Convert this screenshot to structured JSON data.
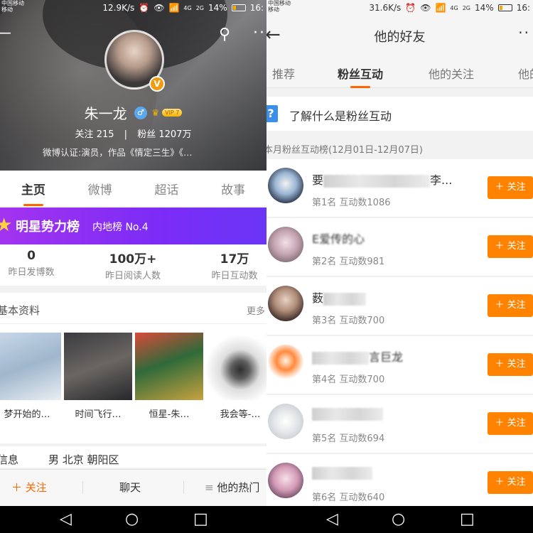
{
  "left": {
    "status": {
      "carrier_line1": "中国移动",
      "carrier_line2": "移动",
      "speed": "12.9K/s",
      "signal1": "4G",
      "signal2": "2G",
      "battery": "14%",
      "time": "16:"
    },
    "profile": {
      "name": "朱一龙",
      "gender_icon": "male-icon",
      "vip_label": "VIP 7",
      "following_label": "关注",
      "following_count": "215",
      "followers_label": "粉丝",
      "followers_count": "1207万",
      "verification": "微博认证:演员，作品《情定三生》《…"
    },
    "tabs": [
      "主页",
      "微博",
      "超话",
      "故事"
    ],
    "banner": {
      "title": "明星势力榜",
      "rank": "内地榜 No.4"
    },
    "numbers": [
      {
        "value": "0",
        "label": "昨日发博数"
      },
      {
        "value": "100万+",
        "label": "昨日阅读人数"
      },
      {
        "value": "17万",
        "label": "昨日互动数"
      }
    ],
    "basic_info": {
      "title": "基本资料",
      "more": "更多"
    },
    "posters": [
      {
        "caption": "梦开始的…"
      },
      {
        "caption": "时间飞行…"
      },
      {
        "caption": "恒星-朱…"
      },
      {
        "caption": "我会等-…"
      }
    ],
    "info_row": {
      "key": "信息",
      "value": "男  北京 朝阳区"
    },
    "bottom": {
      "follow": "关注",
      "chat": "聊天",
      "hot": "他的热门"
    }
  },
  "right": {
    "status": {
      "carrier_line1": "中国移动",
      "carrier_line2": "移动",
      "speed": "31.6K/s",
      "signal1": "4G",
      "signal2": "2G",
      "battery": "14%",
      "time": "16:"
    },
    "title": "他的好友",
    "tabs": [
      "推荐",
      "粉丝互动",
      "他的关注",
      "他的"
    ],
    "about": "了解什么是粉丝互动",
    "rank_header": "本月粉丝互动榜(12月01日-12月07日)",
    "follow_label": "关注",
    "rows": [
      {
        "name_prefix": "要",
        "name_suffix": "李...",
        "meta": "第1名 互动数1086"
      },
      {
        "name_prefix": "E爱传的心",
        "name_suffix": "",
        "meta": "第2名 互动数981"
      },
      {
        "name_prefix": "薮",
        "name_suffix": "",
        "meta": "第3名 互动数700"
      },
      {
        "name_prefix": "",
        "name_suffix": "言巨龙",
        "meta": "第4名 互动数700"
      },
      {
        "name_prefix": "",
        "name_suffix": "",
        "meta": "第5名 互动数694"
      },
      {
        "name_prefix": "",
        "name_suffix": "",
        "meta": "第6名 互动数640"
      }
    ]
  },
  "navbar": {
    "back": "◁",
    "home": "○",
    "recent": "□"
  },
  "colors": {
    "accent": "#ff8200",
    "banner": "#7b2cf6",
    "verify_blue": "#3b8fe8"
  }
}
